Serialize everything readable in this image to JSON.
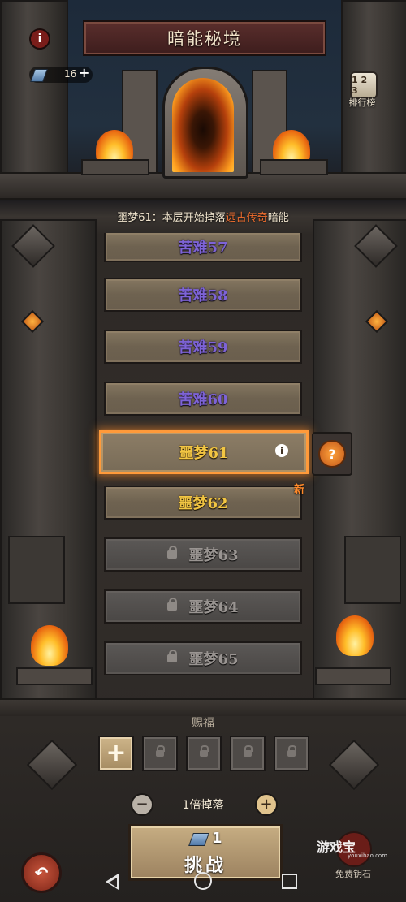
{
  "header": {
    "title": "暗能秘境",
    "info_icon": "i",
    "keys": {
      "count": "16",
      "add_label": "+"
    },
    "rank": {
      "icon_text": "1 2 3",
      "label": "排行榜"
    }
  },
  "notice": {
    "prefix": "噩梦61：本层开始掉落",
    "highlight": "远古传奇",
    "suffix": "暗能"
  },
  "floors": [
    {
      "label": "苦难57"
    },
    {
      "label": "苦难58"
    },
    {
      "label": "苦难59"
    },
    {
      "label": "苦难60"
    },
    {
      "label": "噩梦61"
    },
    {
      "label": "噩梦62"
    },
    {
      "label": "噩梦63"
    },
    {
      "label": "噩梦64"
    },
    {
      "label": "噩梦65"
    }
  ],
  "selected_info_icon": "i",
  "help_label": "?",
  "new_badge": "新",
  "blessing": {
    "title": "赐福",
    "add_label": "+"
  },
  "multiplier": {
    "minus": "−",
    "plus": "+",
    "label": "1倍掉落"
  },
  "challenge": {
    "cost": "1",
    "label": "挑战"
  },
  "back_label": "↶",
  "free_key": {
    "label": "免费钥石"
  },
  "watermark": {
    "brand": "游戏宝",
    "url": "youxibao.com"
  },
  "colors": {
    "affliction": "#7d63d6",
    "nightmare": "#f2c643",
    "highlight": "#f36e2e",
    "selected_border": "#ff9a3a"
  }
}
